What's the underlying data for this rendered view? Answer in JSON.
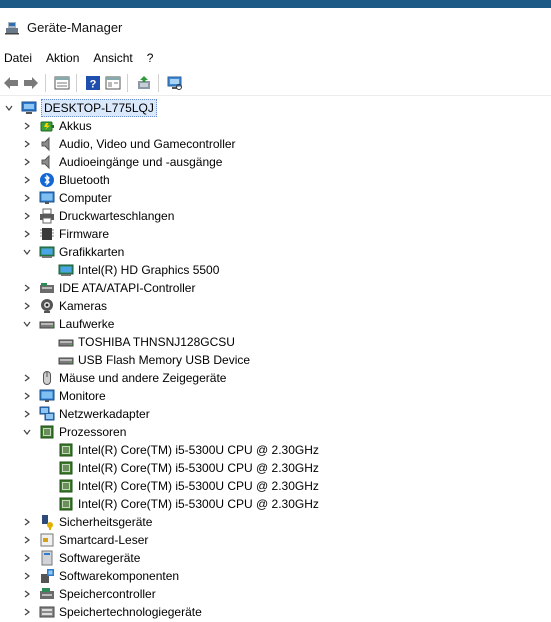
{
  "window": {
    "title": "Geräte-Manager"
  },
  "menu": [
    "Datei",
    "Aktion",
    "Ansicht",
    "?"
  ],
  "toolbar": [
    "back-icon",
    "forward-icon",
    "properties-icon",
    "help-icon",
    "view-icon",
    "update-driver-icon",
    "scan-hardware-icon"
  ],
  "tree": {
    "root": {
      "label": "DESKTOP-L775LQJ",
      "icon": "computer-icon",
      "expanded": true
    },
    "items": [
      {
        "label": "Akkus",
        "icon": "battery-icon",
        "expanded": false
      },
      {
        "label": "Audio, Video und Gamecontroller",
        "icon": "speaker-icon",
        "expanded": false
      },
      {
        "label": "Audioeingänge und -ausgänge",
        "icon": "speaker-icon",
        "expanded": false
      },
      {
        "label": "Bluetooth",
        "icon": "bluetooth-icon",
        "expanded": false
      },
      {
        "label": "Computer",
        "icon": "monitor-icon",
        "expanded": false
      },
      {
        "label": "Druckwarteschlangen",
        "icon": "printer-icon",
        "expanded": false
      },
      {
        "label": "Firmware",
        "icon": "chip-icon",
        "expanded": false
      },
      {
        "label": "Grafikkarten",
        "icon": "display-adapter-icon",
        "expanded": true,
        "children": [
          {
            "label": "Intel(R) HD Graphics 5500",
            "icon": "display-adapter-icon"
          }
        ]
      },
      {
        "label": "IDE ATA/ATAPI-Controller",
        "icon": "ide-controller-icon",
        "expanded": false
      },
      {
        "label": "Kameras",
        "icon": "camera-icon",
        "expanded": false
      },
      {
        "label": "Laufwerke",
        "icon": "drive-icon",
        "expanded": true,
        "children": [
          {
            "label": "TOSHIBA THNSNJ128GCSU",
            "icon": "drive-icon"
          },
          {
            "label": "USB Flash Memory USB Device",
            "icon": "drive-icon"
          }
        ]
      },
      {
        "label": "Mäuse und andere Zeigegeräte",
        "icon": "mouse-icon",
        "expanded": false
      },
      {
        "label": "Monitore",
        "icon": "monitor-icon",
        "expanded": false
      },
      {
        "label": "Netzwerkadapter",
        "icon": "network-icon",
        "expanded": false
      },
      {
        "label": "Prozessoren",
        "icon": "processor-icon",
        "expanded": true,
        "children": [
          {
            "label": "Intel(R) Core(TM) i5-5300U CPU @ 2.30GHz",
            "icon": "processor-icon"
          },
          {
            "label": "Intel(R) Core(TM) i5-5300U CPU @ 2.30GHz",
            "icon": "processor-icon"
          },
          {
            "label": "Intel(R) Core(TM) i5-5300U CPU @ 2.30GHz",
            "icon": "processor-icon"
          },
          {
            "label": "Intel(R) Core(TM) i5-5300U CPU @ 2.30GHz",
            "icon": "processor-icon"
          }
        ]
      },
      {
        "label": "Sicherheitsgeräte",
        "icon": "security-key-icon",
        "expanded": false
      },
      {
        "label": "Smartcard-Leser",
        "icon": "smartcard-icon",
        "expanded": false
      },
      {
        "label": "Softwaregeräte",
        "icon": "software-device-icon",
        "expanded": false
      },
      {
        "label": "Softwarekomponenten",
        "icon": "software-component-icon",
        "expanded": false
      },
      {
        "label": "Speichercontroller",
        "icon": "storage-controller-icon",
        "expanded": false
      },
      {
        "label": "Speichertechnologiegeräte",
        "icon": "storage-tech-icon",
        "expanded": false
      }
    ]
  },
  "colors": {
    "accent": "#0078d7",
    "selection": "#d9e8fb",
    "titlestrip": "#1d5a86"
  }
}
